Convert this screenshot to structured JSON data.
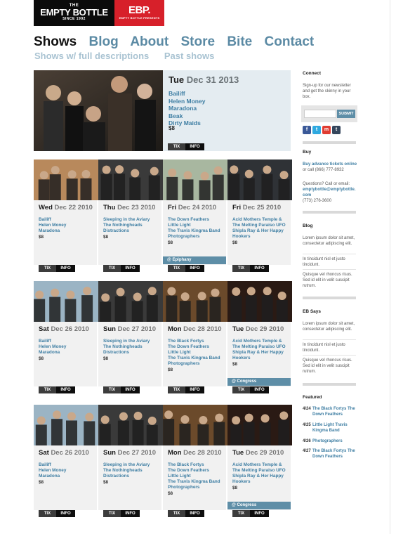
{
  "logo": {
    "line1": "THE",
    "line2": "EMPTY BOTTLE",
    "line3": "SINCE 1992",
    "ebp": "EBP.",
    "ebp_sub": "EMPTY BOTTLE PRESENTS"
  },
  "nav": [
    "Shows",
    "Blog",
    "About",
    "Store",
    "Bite",
    "Contact"
  ],
  "subnav": [
    "Shows w/ full descriptions",
    "Past shows"
  ],
  "featured_show": {
    "dow": "Tue",
    "date": "Dec 31 2013",
    "bands": [
      "Bailiff",
      "Helen Money",
      "Maradona",
      "Beak",
      "Dirty Maids"
    ],
    "price": "$8"
  },
  "buttons": {
    "tix": "TIX",
    "info": "INFO"
  },
  "rows": [
    [
      {
        "dow": "Wed",
        "date": "Dec 22 2010",
        "bands": [
          "Bailiff",
          "Helen Money",
          "Maradona"
        ],
        "price": "$8",
        "venue": ""
      },
      {
        "dow": "Thu",
        "date": "Dec 23 2010",
        "bands": [
          "Sleeping in the Aviary",
          "The Nothingheads",
          "Distractions"
        ],
        "price": "$8",
        "venue": ""
      },
      {
        "dow": "Fri",
        "date": "Dec 24 2010",
        "bands": [
          "The Down Feathers",
          "Little Light",
          "The Travis Kingma Band",
          "Photographers"
        ],
        "price": "$8",
        "venue": "@ Epiphany"
      },
      {
        "dow": "Fri",
        "date": "Dec 25 2010",
        "bands": [
          "Acid Mothers Temple &",
          "The Melting Paraiso UFO",
          "Shipla Ray & Her Happy",
          "Hookers"
        ],
        "price": "$8",
        "venue": ""
      }
    ],
    [
      {
        "dow": "Sat",
        "date": "Dec 26 2010",
        "bands": [
          "Bailiff",
          "Helen Money",
          "Maradona"
        ],
        "price": "$8",
        "venue": ""
      },
      {
        "dow": "Sun",
        "date": "Dec 27 2010",
        "bands": [
          "Sleeping in the Aviary",
          "The Nothingheads",
          "Distractions"
        ],
        "price": "$8",
        "venue": ""
      },
      {
        "dow": "Mon",
        "date": "Dec 28 2010",
        "bands": [
          "The Black Fortys",
          "The Down Feathers",
          "Little Light",
          "The Travis Kingma Band",
          "Photographers"
        ],
        "price": "$8",
        "venue": ""
      },
      {
        "dow": "Tue",
        "date": "Dec 29 2010",
        "bands": [
          "Acid Mothers Temple &",
          "The Melting Paraiso UFO",
          "Shipla Ray & Her Happy",
          "Hookers"
        ],
        "price": "$8",
        "venue": "@ Congress"
      }
    ],
    [
      {
        "dow": "Sat",
        "date": "Dec 26 2010",
        "bands": [
          "Bailiff",
          "Helen Money",
          "Maradona"
        ],
        "price": "$8",
        "venue": ""
      },
      {
        "dow": "Sun",
        "date": "Dec 27 2010",
        "bands": [
          "Sleeping in the Aviary",
          "The Nothingheads",
          "Distractions"
        ],
        "price": "$8",
        "venue": ""
      },
      {
        "dow": "Mon",
        "date": "Dec 28 2010",
        "bands": [
          "The Black Fortys",
          "The Down Feathers",
          "Little Light",
          "The Travis Kingma Band",
          "Photographers"
        ],
        "price": "$8",
        "venue": ""
      },
      {
        "dow": "Tue",
        "date": "Dec 29 2010",
        "bands": [
          "Acid Mothers Temple &",
          "The Melting Paraiso UFO",
          "Shipla Ray & Her Happy",
          "Hookers"
        ],
        "price": "$8",
        "venue": "@ Congress"
      }
    ]
  ],
  "sidebar": {
    "connect_title": "Connect",
    "connect_text": "Sign-up for our newsletter and get the skinny in your box.",
    "submit": "SUBMIT",
    "social": [
      "f",
      "t",
      "m",
      "t"
    ],
    "buy_title": "Buy",
    "buy_link": "Buy advance tickets online",
    "buy_text": "or call (866) 777-8932",
    "questions": "Questions? Call or email:",
    "email": "emptybottle@emptybottle.com",
    "phone": "(773) 276-3600",
    "blog_title": "Blog",
    "blog_items": [
      "Lorem ipsum dolor sit amet, consectetur adipiscing elit.",
      "In tincidunt nisl et justo tincidunt.",
      "Quisque vel rhoncus risus. Sed id elit in velit suscipit rutrum."
    ],
    "ebsays_title": "EB Says",
    "ebsays_items": [
      "Lorem ipsum dolor sit amet, consectetur adipiscing elit.",
      "In tincidunt nisl et justo tincidunt.",
      "Quisque vel rhoncus risus. Sed id elit in velit suscipit rutrum."
    ],
    "featured_title": "Featured",
    "featured": [
      {
        "date": "4/24",
        "bands": "The Black Fortys The Down Feathers"
      },
      {
        "date": "4/25",
        "bands": "Little Light Travis Kingma Band"
      },
      {
        "date": "4/26",
        "bands": "Photographers"
      },
      {
        "date": "4/27",
        "bands": "The Black Fortys The Down Feathers"
      }
    ]
  },
  "colors": {
    "link": "#3e7ea3",
    "venue": "#5e8ea7",
    "ebp_red": "#d7202a"
  }
}
